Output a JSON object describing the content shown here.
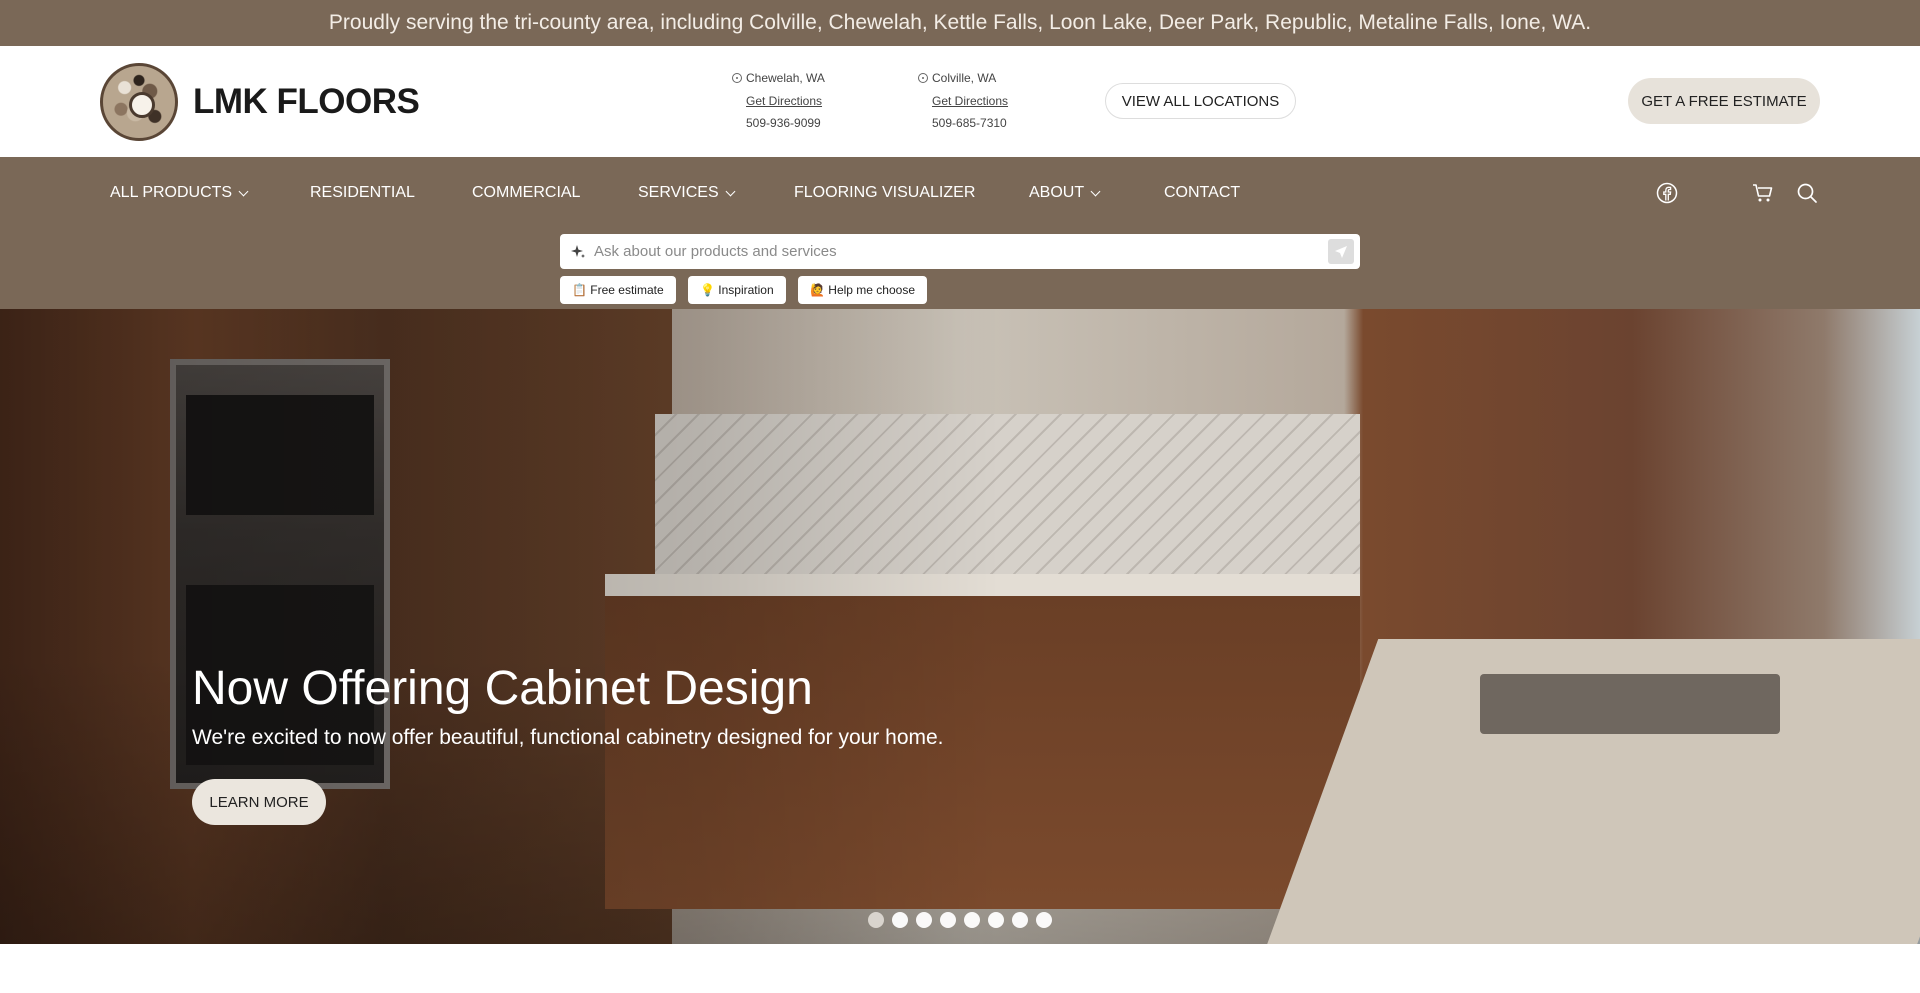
{
  "announcement": "Proudly serving the tri-county area, including Colville, Chewelah, Kettle Falls, Loon Lake, Deer Park, Republic, Metaline Falls, Ione, WA.",
  "brand": {
    "name": "LMK FLOORS"
  },
  "locations": [
    {
      "city": "Chewelah, WA",
      "directions": "Get Directions",
      "phone": "509-936-9099"
    },
    {
      "city": "Colville, WA",
      "directions": "Get Directions",
      "phone": "509-685-7310"
    }
  ],
  "header": {
    "view_locations": "VIEW ALL LOCATIONS",
    "estimate": "GET A FREE ESTIMATE"
  },
  "nav": {
    "items": [
      {
        "label": "ALL PRODUCTS",
        "dropdown": true
      },
      {
        "label": "RESIDENTIAL",
        "dropdown": false
      },
      {
        "label": "COMMERCIAL",
        "dropdown": false
      },
      {
        "label": "SERVICES",
        "dropdown": true
      },
      {
        "label": "FLOORING VISUALIZER",
        "dropdown": false
      },
      {
        "label": "ABOUT",
        "dropdown": true
      },
      {
        "label": "CONTACT",
        "dropdown": false
      }
    ],
    "icons": [
      "facebook-icon",
      "cart-icon",
      "search-icon"
    ]
  },
  "assistant": {
    "placeholder": "Ask about our products and services",
    "chips": [
      "📋 Free estimate",
      "💡 Inspiration",
      "🙋 Help me choose"
    ]
  },
  "hero": {
    "title": "Now Offering Cabinet Design",
    "subtitle": "We're excited to now offer beautiful, functional cabinetry designed for your home.",
    "button": "LEARN MORE",
    "slide_count": 8,
    "active_slide": 1
  },
  "colors": {
    "brand_brown": "#7a6857",
    "button_light": "#e7e2da",
    "text_dark": "#1a1a1a"
  }
}
